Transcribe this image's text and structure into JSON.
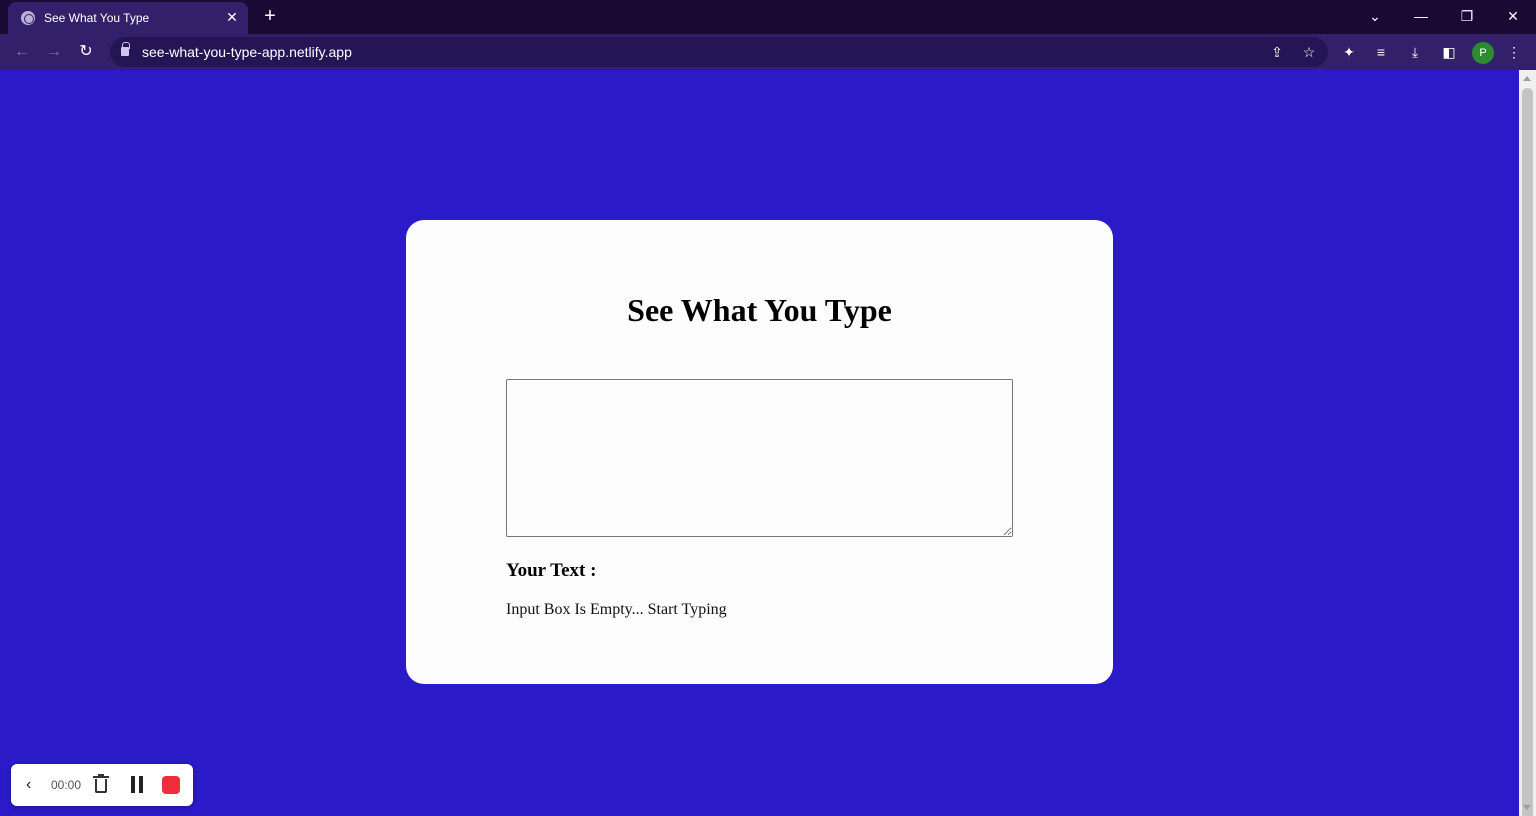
{
  "browser": {
    "tab": {
      "title": "See What You Type",
      "close": "✕"
    },
    "new_tab": "+",
    "window": {
      "tab_search": "⌄",
      "minimize": "—",
      "restore": "❐",
      "close": "✕"
    },
    "nav": {
      "back": "←",
      "forward": "→",
      "reload": "↻"
    },
    "address": "see-what-you-type-app.netlify.app",
    "icons": {
      "share": "⇪",
      "bookmark": "☆",
      "extensions": "✦",
      "media": "≡",
      "download": "⤓",
      "side_panel": "◧",
      "menu": "⋮"
    },
    "profile_initial": "P"
  },
  "page": {
    "heading": "See What You Type",
    "textarea_value": "",
    "output_label": "Your Text :",
    "output_text": "Input Box Is Empty... Start Typing"
  },
  "recorder": {
    "back": "‹",
    "time": "00:00"
  },
  "colors": {
    "page_background": "#2a1ac8",
    "titlebar": "#1a0a33",
    "toolbar": "#33206a",
    "card": "#fdfdfd",
    "record_stop": "#ee2e3d",
    "avatar": "#2e8b32"
  }
}
